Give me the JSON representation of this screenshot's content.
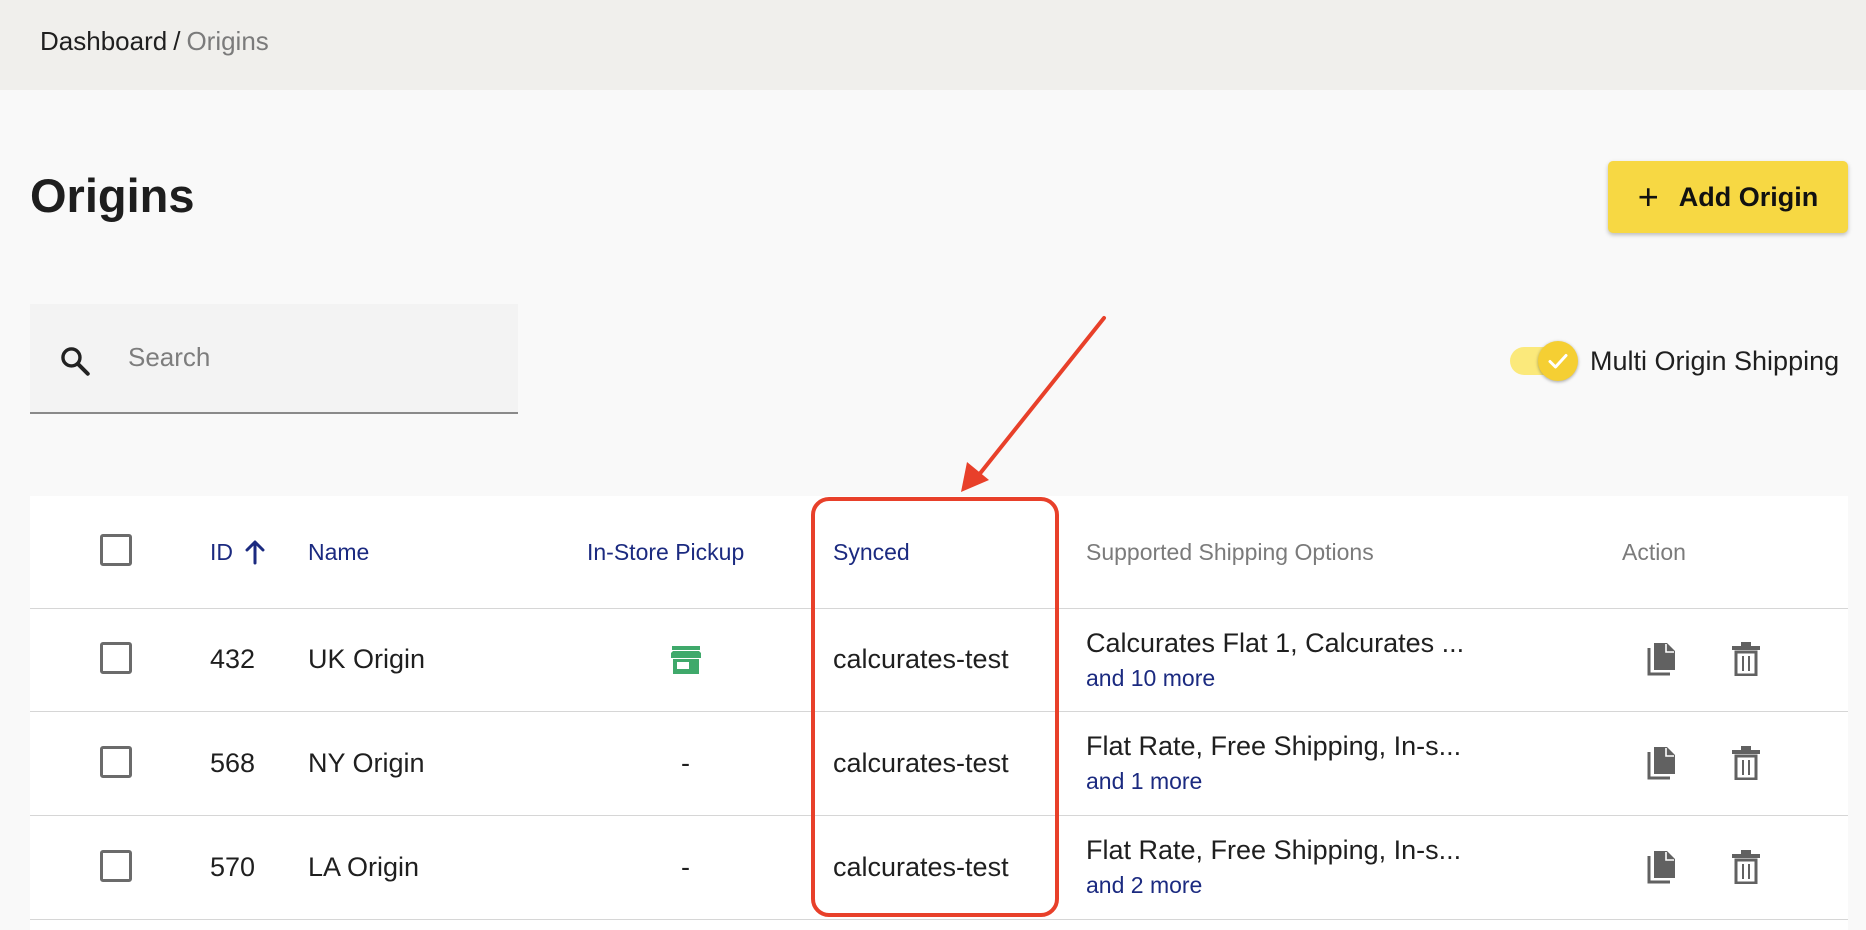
{
  "breadcrumb": {
    "root": "Dashboard",
    "separator": "/",
    "current": "Origins"
  },
  "page": {
    "title": "Origins"
  },
  "toolbar": {
    "add_label": "Add Origin",
    "add_icon": "plus-icon"
  },
  "search": {
    "placeholder": "Search",
    "value": ""
  },
  "toggle": {
    "label": "Multi Origin Shipping",
    "checked": true
  },
  "table": {
    "columns": {
      "id": "ID",
      "name": "Name",
      "pickup": "In-Store Pickup",
      "synced": "Synced",
      "shipping": "Supported Shipping Options",
      "action": "Action"
    },
    "sort": {
      "column": "ID",
      "direction": "ascending"
    },
    "rows": [
      {
        "id": "432",
        "name": "UK Origin",
        "pickup": "store-icon",
        "pickup_text": "",
        "synced": "calcurates-test",
        "shipping": "Calcurates Flat 1, Calcurates ...",
        "more": "and 10 more"
      },
      {
        "id": "568",
        "name": "NY Origin",
        "pickup": "none",
        "pickup_text": "-",
        "synced": "calcurates-test",
        "shipping": "Flat Rate, Free Shipping, In-s...",
        "more": "and 1 more"
      },
      {
        "id": "570",
        "name": "LA Origin",
        "pickup": "none",
        "pickup_text": "-",
        "synced": "calcurates-test",
        "shipping": "Flat Rate, Free Shipping, In-s...",
        "more": "and 2 more"
      }
    ]
  },
  "colors": {
    "accent": "#f7d843",
    "link": "#1b2a80",
    "annotation": "#e8402a",
    "store_icon": "#3fa96b"
  }
}
